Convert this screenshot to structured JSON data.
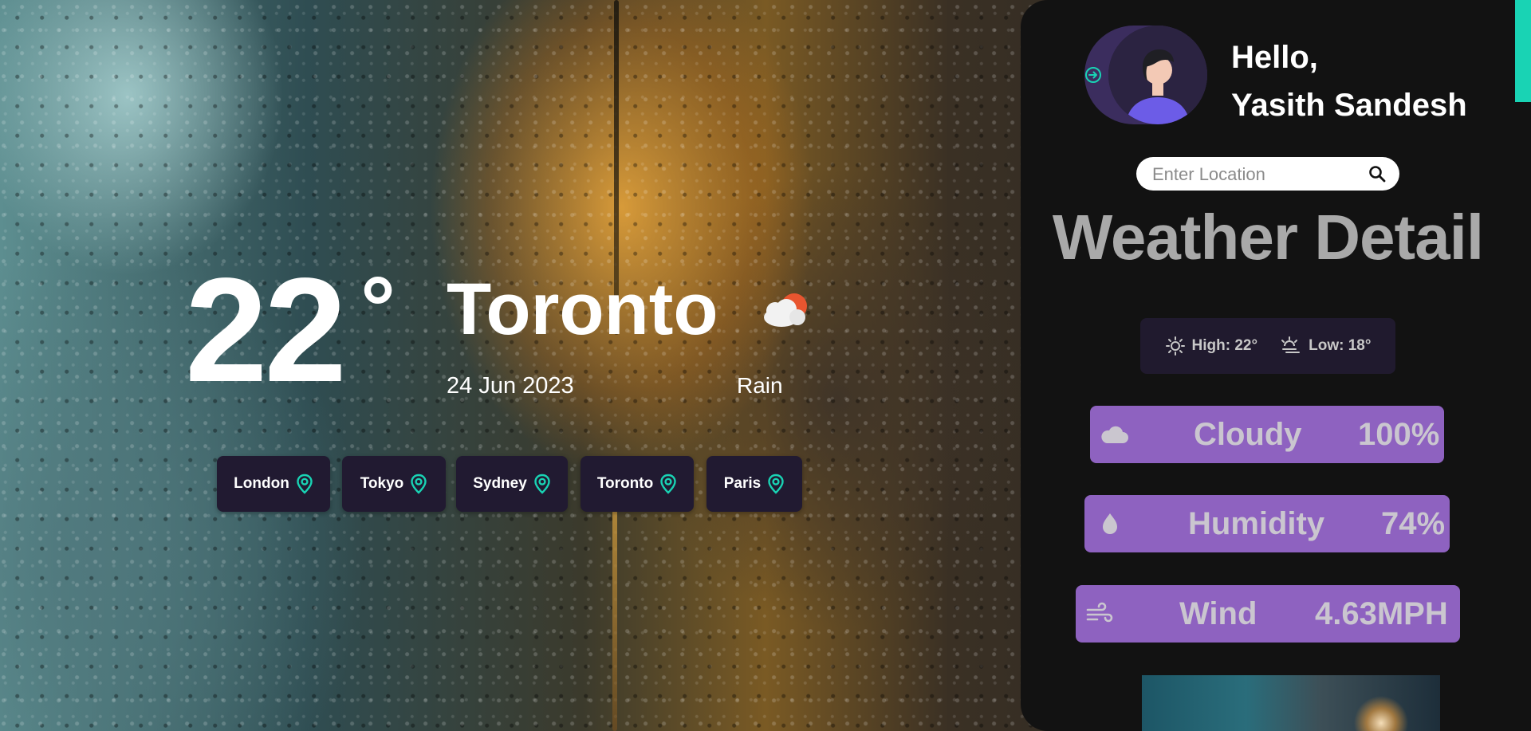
{
  "hero": {
    "temperature": "22",
    "degree": "°",
    "city": "Toronto",
    "date": "24 Jun 2023",
    "condition": "Rain",
    "condition_icon": "partly-cloudy-icon"
  },
  "quick_cities": [
    {
      "label": "London"
    },
    {
      "label": "Tokyo"
    },
    {
      "label": "Sydney"
    },
    {
      "label": "Toronto"
    },
    {
      "label": "Paris"
    }
  ],
  "profile": {
    "greeting": "Hello,",
    "name": "Yasith Sandesh"
  },
  "search": {
    "placeholder": "Enter Location",
    "value": ""
  },
  "details": {
    "title": "Weather Detail",
    "high_label": "High: 22°",
    "low_label": "Low: 18°",
    "cloudy_label": "Cloudy",
    "cloudy_value": "100%",
    "humidity_label": "Humidity",
    "humidity_value": "74%",
    "wind_label": "Wind",
    "wind_value": "4.63MPH"
  },
  "colors": {
    "accent": "#19d3b4",
    "panel": "#121212",
    "chip": "#211a31",
    "stat_card": "#8e62c0"
  }
}
